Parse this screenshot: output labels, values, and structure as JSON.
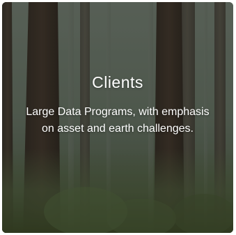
{
  "card": {
    "title": "Clients",
    "description": "Large Data Programs, with emphasis on asset and earth challenges."
  }
}
